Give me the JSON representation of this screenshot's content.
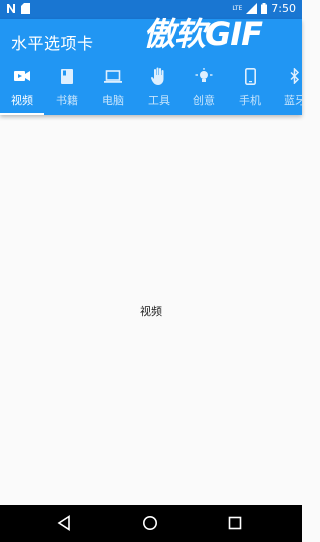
{
  "status_bar": {
    "network": "LTE",
    "time": "7:50"
  },
  "watermark": "傲软GIF",
  "app_bar": {
    "title": "水平选项卡"
  },
  "tabs": [
    {
      "label": "视频",
      "icon": "videocam-icon",
      "active": true
    },
    {
      "label": "书籍",
      "icon": "book-icon",
      "active": false
    },
    {
      "label": "电脑",
      "icon": "laptop-icon",
      "active": false
    },
    {
      "label": "工具",
      "icon": "hand-icon",
      "active": false
    },
    {
      "label": "创意",
      "icon": "lightbulb-icon",
      "active": false
    },
    {
      "label": "手机",
      "icon": "phone-icon",
      "active": false
    },
    {
      "label": "蓝牙",
      "icon": "bluetooth-icon",
      "active": false
    }
  ],
  "content": {
    "text": "视频"
  },
  "nav_bar": {
    "buttons": [
      "back-button",
      "home-button",
      "recents-button"
    ]
  }
}
